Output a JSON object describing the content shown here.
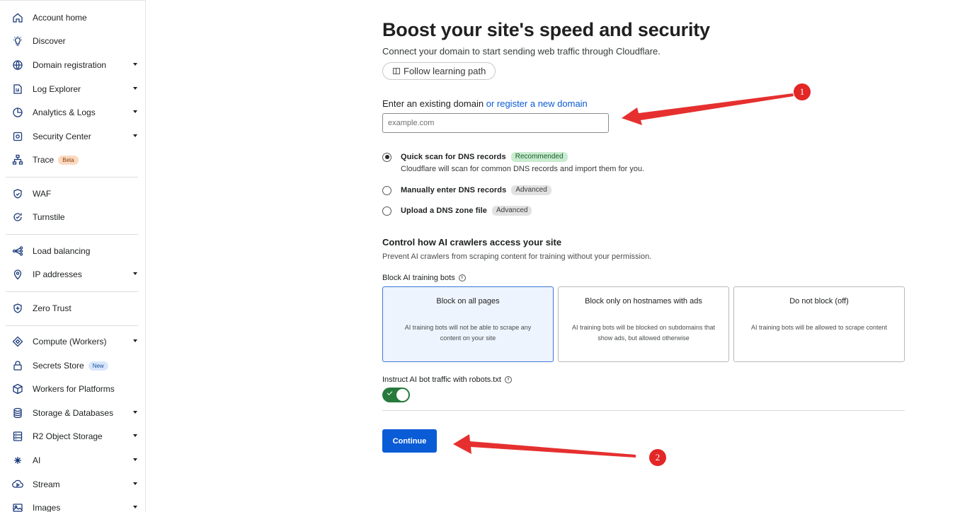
{
  "sidebar": {
    "items": [
      {
        "label": "Account home",
        "icon": "home-icon"
      },
      {
        "label": "Discover",
        "icon": "lightbulb-icon"
      },
      {
        "label": "Domain registration",
        "icon": "globe-icon"
      },
      {
        "label": "Log Explorer",
        "icon": "log-icon"
      },
      {
        "label": "Analytics & Logs",
        "icon": "chart-icon"
      },
      {
        "label": "Security Center",
        "icon": "security-icon"
      },
      {
        "label": "Trace",
        "icon": "trace-icon",
        "badge": "Beta"
      },
      {
        "label": "WAF",
        "icon": "waf-icon"
      },
      {
        "label": "Turnstile",
        "icon": "turnstile-icon"
      },
      {
        "label": "Load balancing",
        "icon": "load-balancer-icon"
      },
      {
        "label": "IP addresses",
        "icon": "location-pin-icon"
      },
      {
        "label": "Zero Trust",
        "icon": "shield-icon"
      },
      {
        "label": "Compute (Workers)",
        "icon": "workers-icon"
      },
      {
        "label": "Secrets Store",
        "icon": "lock-icon",
        "badge": "New"
      },
      {
        "label": "Workers for Platforms",
        "icon": "cube-icon"
      },
      {
        "label": "Storage & Databases",
        "icon": "database-icon"
      },
      {
        "label": "R2 Object Storage",
        "icon": "storage-icon"
      },
      {
        "label": "AI",
        "icon": "sparkle-icon"
      },
      {
        "label": "Stream",
        "icon": "stream-icon"
      },
      {
        "label": "Images",
        "icon": "image-icon"
      }
    ]
  },
  "main": {
    "title": "Boost your site's speed and security",
    "subtitle": "Connect your domain to start sending web traffic through Cloudflare.",
    "learning_path_label": "Follow learning path",
    "domain_prompt": "Enter an existing domain",
    "register_link": "or register a new domain",
    "domain_placeholder": "example.com",
    "domain_value": "",
    "dns_options": [
      {
        "label": "Quick scan for DNS records",
        "tag": "Recommended",
        "description": "Cloudflare will scan for common DNS records and import them for you.",
        "selected": true
      },
      {
        "label": "Manually enter DNS records",
        "tag": "Advanced",
        "selected": false
      },
      {
        "label": "Upload a DNS zone file",
        "tag": "Advanced",
        "selected": false
      }
    ],
    "ai_section_title": "Control how AI crawlers access your site",
    "ai_section_desc": "Prevent AI crawlers from scraping content for training without your permission.",
    "block_label": "Block AI training bots",
    "block_options": [
      {
        "title": "Block on all pages",
        "description": "AI training bots will not be able to scrape any content on your site",
        "selected": true
      },
      {
        "title": "Block only on hostnames with ads",
        "description": "AI training bots will be blocked on subdomains that show ads, but allowed otherwise",
        "selected": false
      },
      {
        "title": "Do not block (off)",
        "description": "AI training bots will be allowed to scrape content",
        "selected": false
      }
    ],
    "robots_label": "Instruct AI bot traffic with robots.txt",
    "robots_enabled": true,
    "continue_label": "Continue"
  },
  "annotations": [
    {
      "number": "1",
      "color": "#e32626"
    },
    {
      "number": "2",
      "color": "#e32626"
    }
  ]
}
